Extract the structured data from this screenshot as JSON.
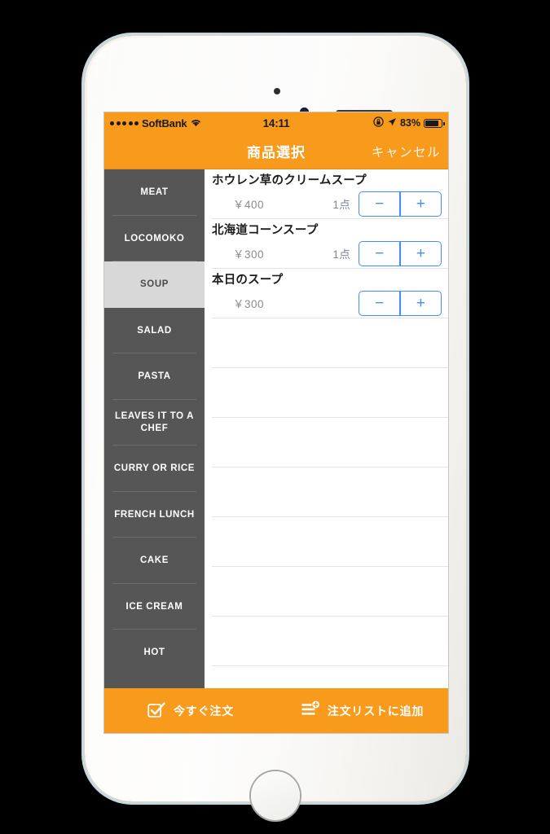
{
  "status_bar": {
    "signal_dots": 5,
    "carrier": "SoftBank",
    "wifi_icon": "wifi-icon",
    "time": "14:11",
    "rotation_lock_icon": "rotation-lock-icon",
    "location_icon": "location-arrow-icon",
    "battery_percent": "83%",
    "battery_level": 83
  },
  "nav": {
    "title": "商品選択",
    "cancel_label": "キャンセル"
  },
  "sidebar": {
    "items": [
      {
        "label": "MEAT",
        "selected": false
      },
      {
        "label": "LOCOMOKO",
        "selected": false
      },
      {
        "label": "SOUP",
        "selected": true
      },
      {
        "label": "SALAD",
        "selected": false
      },
      {
        "label": "PASTA",
        "selected": false
      },
      {
        "label": "LEAVES IT TO A CHEF",
        "selected": false
      },
      {
        "label": "CURRY OR RICE",
        "selected": false
      },
      {
        "label": "FRENCH LUNCH",
        "selected": false
      },
      {
        "label": "CAKE",
        "selected": false
      },
      {
        "label": "ICE CREAM",
        "selected": false
      },
      {
        "label": "HOT",
        "selected": false
      }
    ]
  },
  "list": {
    "items": [
      {
        "name": "ホウレン草のクリームスープ",
        "price": "￥400",
        "qty": "1点",
        "minus": "−",
        "plus": "+"
      },
      {
        "name": "北海道コーンスープ",
        "price": "￥300",
        "qty": "1点",
        "minus": "−",
        "plus": "+"
      },
      {
        "name": "本日のスープ",
        "price": "￥300",
        "qty": "",
        "minus": "−",
        "plus": "+"
      }
    ],
    "empty_rows": 7
  },
  "toolbar": {
    "order_now_label": "今すぐ注文",
    "order_now_icon": "checkbox-check-icon",
    "add_to_list_label": "注文リストに追加",
    "add_to_list_icon": "list-add-icon"
  },
  "colors": {
    "brand_orange": "#f89a1c",
    "sidebar_gray": "#565656",
    "sidebar_selected": "#d8d8d8",
    "stepper_blue": "#3f8efc"
  }
}
